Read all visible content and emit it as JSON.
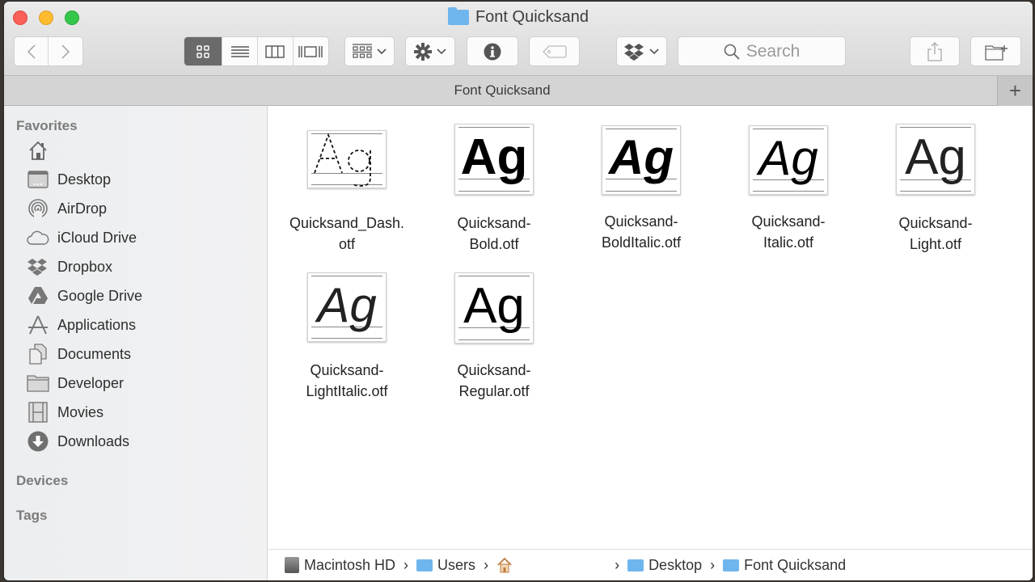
{
  "window": {
    "title": "Font Quicksand"
  },
  "toolbar": {
    "back_icon": "chevron-left",
    "forward_icon": "chevron-right",
    "view_modes": [
      {
        "name": "icon-view",
        "glyph": "▦",
        "active": true
      },
      {
        "name": "list-view",
        "glyph": "☰",
        "active": false
      },
      {
        "name": "column-view",
        "glyph": "▥",
        "active": false
      },
      {
        "name": "cover-flow-view",
        "glyph": "▯",
        "active": false
      }
    ],
    "search_placeholder": "Search"
  },
  "tabbar": {
    "tab_label": "Font Quicksand",
    "add_label": "+"
  },
  "sidebar": {
    "favorites_title": "Favorites",
    "items": [
      {
        "label": "",
        "icon": "home"
      },
      {
        "label": "Desktop",
        "icon": "desktop"
      },
      {
        "label": "AirDrop",
        "icon": "airdrop"
      },
      {
        "label": "iCloud Drive",
        "icon": "cloud"
      },
      {
        "label": "Dropbox",
        "icon": "dropbox"
      },
      {
        "label": "Google Drive",
        "icon": "google-drive"
      },
      {
        "label": "Applications",
        "icon": "applications"
      },
      {
        "label": "Documents",
        "icon": "documents"
      },
      {
        "label": "Developer",
        "icon": "folder"
      },
      {
        "label": "Movies",
        "icon": "film"
      },
      {
        "label": "Downloads",
        "icon": "download"
      }
    ],
    "devices_title": "Devices",
    "tags_title": "Tags"
  },
  "files": [
    {
      "line1": "Quicksand_Dash.",
      "line2": "otf",
      "preview": "Ag",
      "style": "dash"
    },
    {
      "line1": "Quicksand-",
      "line2": "Bold.otf",
      "preview": "Ag",
      "style": "bold"
    },
    {
      "line1": "Quicksand-",
      "line2": "BoldItalic.otf",
      "preview": "Ag",
      "style": "bold-italic"
    },
    {
      "line1": "Quicksand-",
      "line2": "Italic.otf",
      "preview": "Ag",
      "style": "italic"
    },
    {
      "line1": "Quicksand-",
      "line2": "Light.otf",
      "preview": "Ag",
      "style": "light"
    },
    {
      "line1": "Quicksand-",
      "line2": "LightItalic.otf",
      "preview": "Ag",
      "style": "light-italic"
    },
    {
      "line1": "Quicksand-",
      "line2": "Regular.otf",
      "preview": "Ag",
      "style": "regular"
    }
  ],
  "pathbar": {
    "items": [
      "Macintosh HD",
      "Users",
      "",
      "Desktop",
      "Font Quicksand"
    ],
    "separator": "›"
  }
}
